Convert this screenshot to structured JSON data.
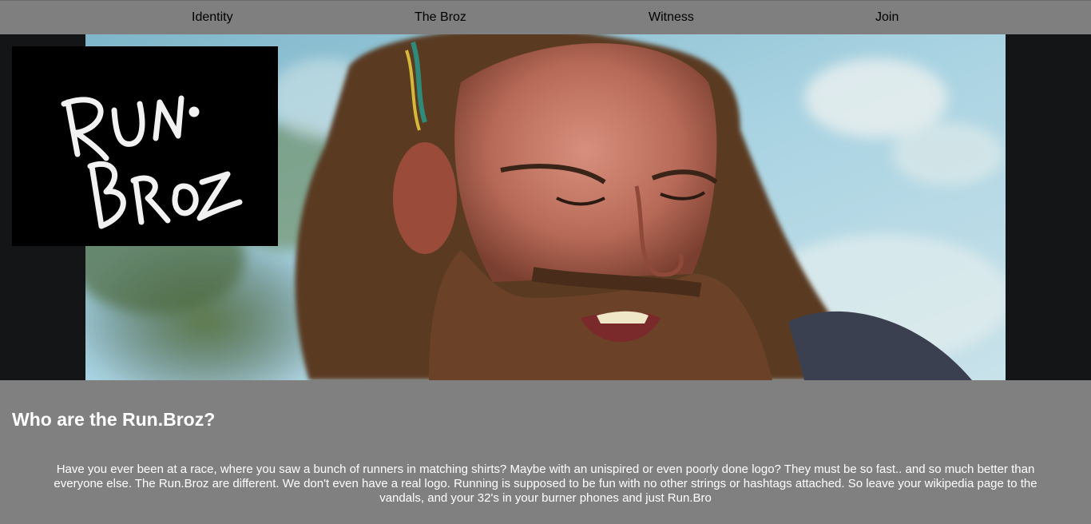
{
  "nav": {
    "items": [
      {
        "label": "Identity"
      },
      {
        "label": "The Broz"
      },
      {
        "label": "Witness"
      },
      {
        "label": "Join"
      }
    ]
  },
  "logo": {
    "text": "RUN. BROZ"
  },
  "about": {
    "heading": "Who are the Run.Broz?",
    "body": "Have you ever been at a race, where you saw a bunch of runners in matching shirts? Maybe with an unispired or even poorly done logo? They must be so fast.. and so much better than everyone else. The Run.Broz are different. We don't even have a real logo. Running is supposed to be fun with no other strings or hashtags attached. So leave your wikipedia page to the vandals, and your 32's in your burner phones and just Run.Bro"
  },
  "colors": {
    "nav_bg": "#7f7f7f",
    "hero_bg": "#141516",
    "content_bg": "#808080",
    "text_light": "#ffffff",
    "text_dark": "#000000"
  }
}
